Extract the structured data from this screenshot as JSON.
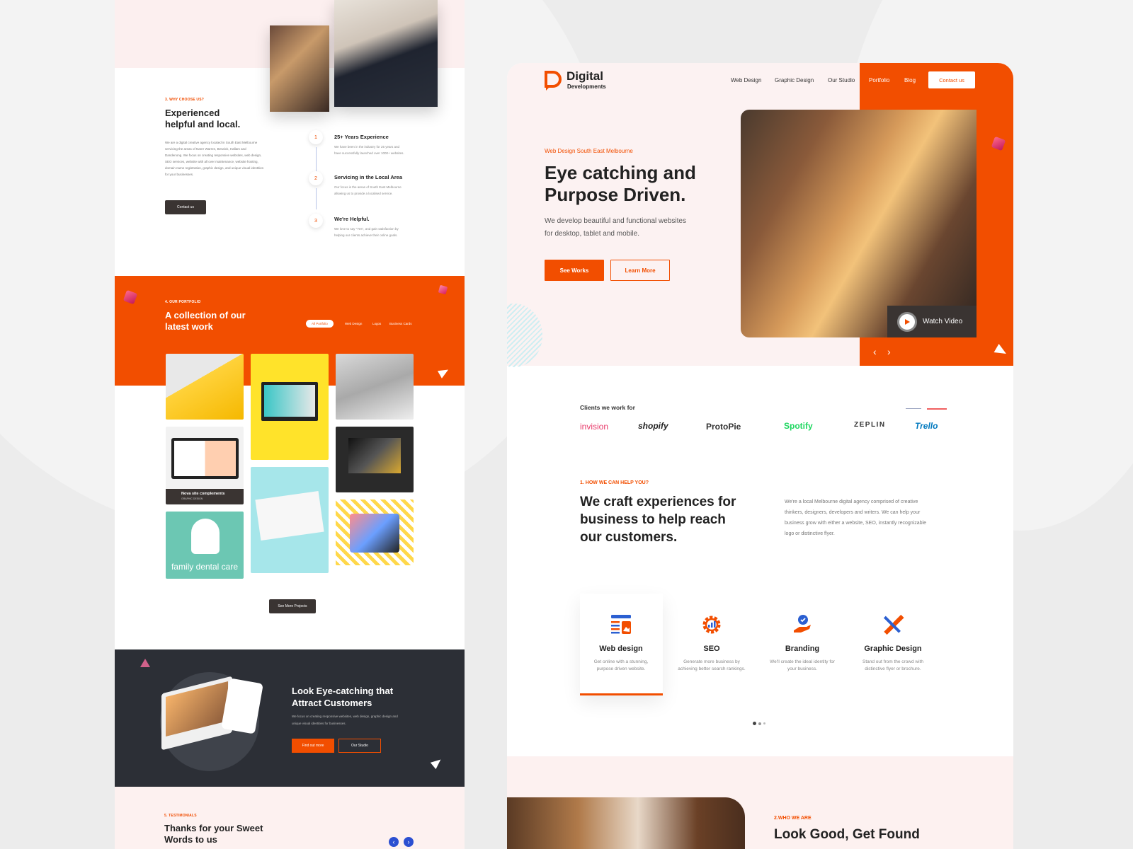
{
  "left_page": {
    "why": {
      "eyebrow": "3. WHY CHOOSE US?",
      "title_line1": "Experienced",
      "title_line2": "helpful and local.",
      "body": "We are a digital creative agency located in South East Melbourne servicing the areas of Narre Warren, Berwick, Hallam and Dandenong. We focus on creating responsive websites, web design, SEO services, website with all over maintenance, website hosting, domain name registration, graphic design, and unique visual identities for your businesses.",
      "button": "Contact us"
    },
    "steps": [
      {
        "num": "1",
        "title": "25+ Years Experience",
        "text": "We have been in the industry for 25 years and have successfully launched over 1000+ websites."
      },
      {
        "num": "2",
        "title": "Servicing in the Local Area",
        "text": "Our focus is the areas of South East Melbourne allowing us to provide a localised service."
      },
      {
        "num": "3",
        "title": "We're Helpful.",
        "text": "We love to say \"Yes\", and gain satisfaction by helping our clients achieve their online goals."
      }
    ],
    "portfolio": {
      "eyebrow": "4. OUR PORTFOLIO",
      "title_line1": "A collection of our",
      "title_line2": "latest work",
      "filters": [
        "All Portfolio",
        "Web Design",
        "Logos",
        "Business Cards"
      ],
      "tile_caption_title": "Nova site complements",
      "tile_caption_sub": "GRAPHIC DESIGN",
      "dental_text": "family dental care",
      "more_button": "See More Projects"
    },
    "cta": {
      "title_line1": "Look Eye-catching that",
      "title_line2": "Attract Customers",
      "body": "We focus on creating responsive websites, web design, graphic design and unique visual identities for businesses.",
      "primary": "Find out more",
      "secondary": "Our Studio"
    },
    "testimonials": {
      "eyebrow": "5. TESTIMONIALS",
      "title_line1": "Thanks for your Sweet",
      "title_line2": "Words to us"
    }
  },
  "right_page": {
    "brand": {
      "name": "Digital",
      "sub": "Developments"
    },
    "nav": [
      "Web Design",
      "Graphic Design",
      "Our Studio",
      "Portfolio",
      "Blog"
    ],
    "nav_cta": "Contact us",
    "hero": {
      "eyebrow": "Web Design South East Melbourne",
      "title_line1": "Eye catching and",
      "title_line2": "Purpose Driven.",
      "body_line1": "We develop beautiful and functional websites",
      "body_line2": "for desktop, tablet and mobile.",
      "primary": "See Works",
      "secondary": "Learn More",
      "video_label": "Watch Video"
    },
    "clients": {
      "title": "Clients we work for",
      "logos": [
        "invision",
        "shopify",
        "ProtoPie",
        "Spotify",
        "ZEPLIN",
        "Trello"
      ]
    },
    "help": {
      "eyebrow": "1. HOW WE CAN HELP YOU?",
      "title_line1": "We craft experiences for",
      "title_line2": "business to help reach",
      "title_line3": "our customers.",
      "body": "We're a local Melbourne digital agency comprised of creative thinkers, designers, developers and writers. We can help your business grow with either a website, SEO, instantly recognizable logo or distinctive flyer."
    },
    "services": [
      {
        "icon": "web-design-icon",
        "title": "Web design",
        "desc": "Get online with a stunning, purpose driven website."
      },
      {
        "icon": "seo-gear-icon",
        "title": "SEO",
        "desc": "Generate more business by achieving better search rankings."
      },
      {
        "icon": "branding-hand-icon",
        "title": "Branding",
        "desc": "We'll create the ideal identity for your business."
      },
      {
        "icon": "pencil-ruler-icon",
        "title": "Graphic Design",
        "desc": "Stand out from the crowd with distinctive flyer or brochure."
      }
    ],
    "who": {
      "eyebrow": "2.WHO WE ARE",
      "title_line1": "Look Good, Get Found"
    }
  },
  "colors": {
    "accent": "#f24e00",
    "dark": "#2c2f36",
    "blush": "#fcf2f2"
  }
}
